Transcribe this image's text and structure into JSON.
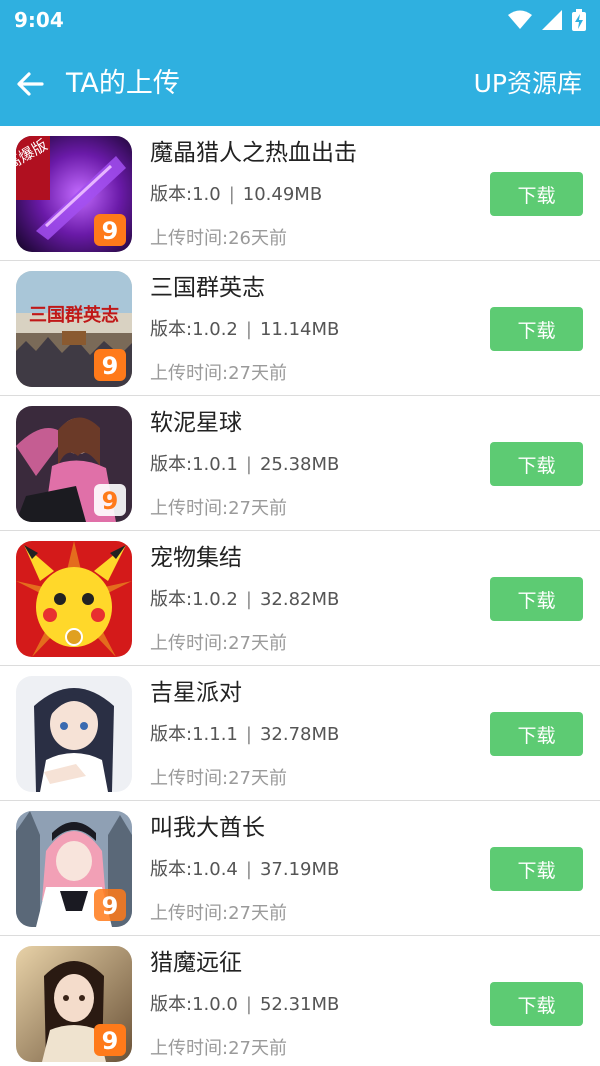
{
  "status_bar": {
    "time": "9:04"
  },
  "app_bar": {
    "title": "TA的上传",
    "action": "UP资源库"
  },
  "items": [
    {
      "name": "魔晶猎人之热血出击",
      "version": "版本:1.0",
      "size": "10.49MB",
      "upload_time": "上传时间:26天前",
      "button": "下载",
      "badge": "高爆版"
    },
    {
      "name": "三国群英志",
      "version": "版本:1.0.2",
      "size": "11.14MB",
      "upload_time": "上传时间:27天前",
      "button": "下载",
      "banner": "三国群英志"
    },
    {
      "name": "软泥星球",
      "version": "版本:1.0.1",
      "size": "25.38MB",
      "upload_time": "上传时间:27天前",
      "button": "下载"
    },
    {
      "name": "宠物集结",
      "version": "版本:1.0.2",
      "size": "32.82MB",
      "upload_time": "上传时间:27天前",
      "button": "下载"
    },
    {
      "name": "吉星派对",
      "version": "版本:1.1.1",
      "size": "32.78MB",
      "upload_time": "上传时间:27天前",
      "button": "下载"
    },
    {
      "name": "叫我大酋长",
      "version": "版本:1.0.4",
      "size": "37.19MB",
      "upload_time": "上传时间:27天前",
      "button": "下载"
    },
    {
      "name": "猎魔远征",
      "version": "版本:1.0.0",
      "size": "52.31MB",
      "upload_time": "上传时间:27天前",
      "button": "下载"
    }
  ],
  "colors": {
    "header": "#2fb0e0",
    "button": "#5dcb73",
    "divider": "#dcdcdc"
  },
  "separator": "|"
}
